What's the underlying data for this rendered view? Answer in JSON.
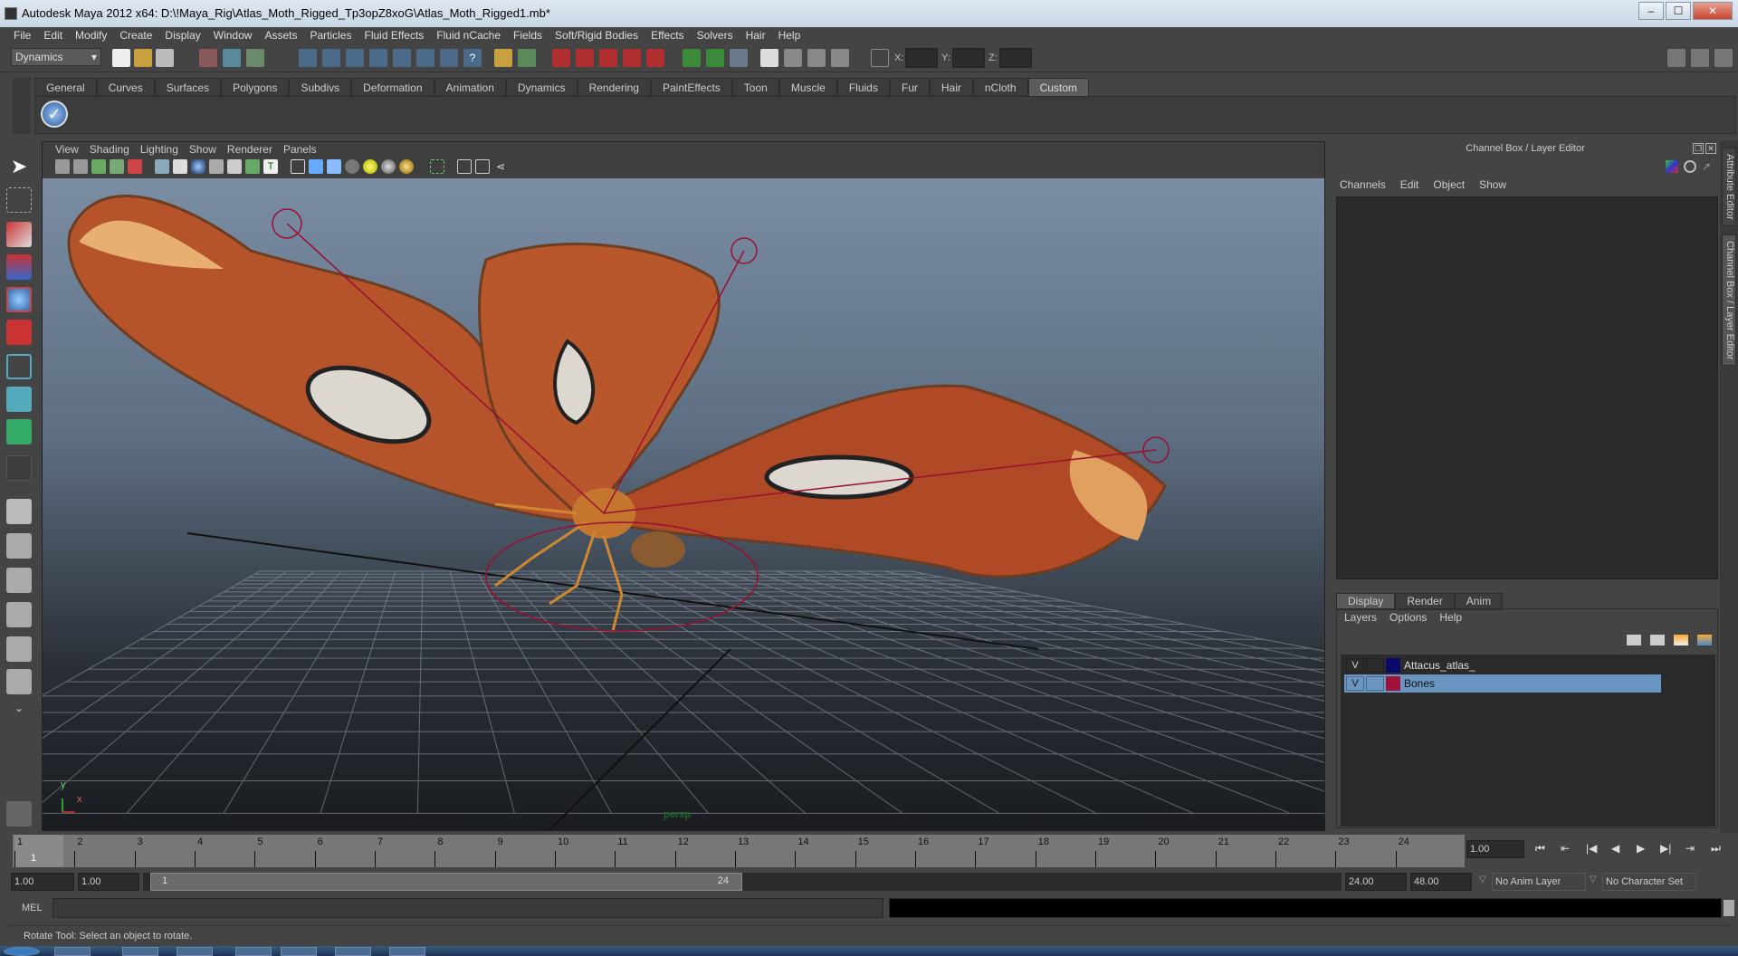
{
  "window": {
    "title": "Autodesk Maya 2012 x64: D:\\!Maya_Rig\\Atlas_Moth_Rigged_Tp3opZ8xoG\\Atlas_Moth_Rigged1.mb*",
    "minimize": "–",
    "maximize": "☐",
    "close": "✕"
  },
  "menubar": [
    "File",
    "Edit",
    "Modify",
    "Create",
    "Display",
    "Window",
    "Assets",
    "Particles",
    "Fluid Effects",
    "Fluid nCache",
    "Fields",
    "Soft/Rigid Bodies",
    "Effects",
    "Solvers",
    "Hair",
    "Help"
  ],
  "statusline": {
    "mode": "Dynamics",
    "x_label": "X:",
    "y_label": "Y:",
    "z_label": "Z:"
  },
  "shelf": {
    "tabs": [
      "General",
      "Curves",
      "Surfaces",
      "Polygons",
      "Subdivs",
      "Deformation",
      "Animation",
      "Dynamics",
      "Rendering",
      "PaintEffects",
      "Toon",
      "Muscle",
      "Fluids",
      "Fur",
      "Hair",
      "nCloth",
      "Custom"
    ],
    "active": "Custom"
  },
  "viewport": {
    "menu": [
      "View",
      "Shading",
      "Lighting",
      "Show",
      "Renderer",
      "Panels"
    ],
    "camera": "persp",
    "axis_y": "y",
    "axis_x": "x"
  },
  "channel_box": {
    "title": "Channel Box / Layer Editor",
    "menu": [
      "Channels",
      "Edit",
      "Object",
      "Show"
    ]
  },
  "layer_editor": {
    "tabs": [
      "Display",
      "Render",
      "Anim"
    ],
    "menu": [
      "Layers",
      "Options",
      "Help"
    ],
    "layers": [
      {
        "visible": "V",
        "name": "Attacus_atlas_",
        "color": "#0a0a6e",
        "selected": false
      },
      {
        "visible": "V",
        "name": "Bones",
        "color": "#a0123a",
        "selected": true
      }
    ]
  },
  "side_tabs": [
    "Attribute Editor",
    "Channel Box / Layer Editor"
  ],
  "timeline": {
    "ticks": [
      "1",
      "2",
      "3",
      "4",
      "5",
      "6",
      "7",
      "8",
      "9",
      "10",
      "11",
      "12",
      "13",
      "14",
      "15",
      "16",
      "17",
      "18",
      "19",
      "20",
      "21",
      "22",
      "23",
      "24"
    ],
    "current_frame": "1",
    "current_time": "1.00"
  },
  "playback": {
    "buttons": [
      "⏮",
      "⇤",
      "|◀",
      "◀",
      "▶",
      "▶|",
      "⇥",
      "⏭"
    ]
  },
  "range": {
    "start": "1.00",
    "anim_start": "1.00",
    "slider_start": "1",
    "slider_end": "24",
    "end": "24.00",
    "anim_end": "48.00",
    "anim_layer": "No Anim Layer",
    "character_set": "No Character Set"
  },
  "command_line": {
    "label": "MEL"
  },
  "help_line": "Rotate Tool: Select an object to rotate."
}
